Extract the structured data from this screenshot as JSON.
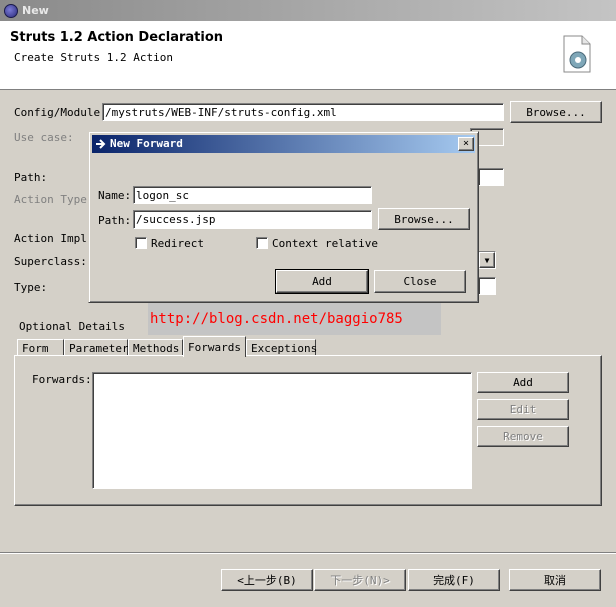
{
  "window": {
    "title": "New"
  },
  "header": {
    "title": "Struts 1.2 Action Declaration",
    "subtitle": "Create Struts 1.2 Action"
  },
  "form": {
    "config_label": "Config/Module:",
    "config_value": "/mystruts/WEB-INF/struts-config.xml",
    "browse_label": "Browse...",
    "usecase_label": "Use case:",
    "path_label": "Path:",
    "action_type_label": "Action Type:",
    "action_impl_label": "Action Impl:",
    "superclass_label": "Superclass:",
    "type_label": "Type:"
  },
  "dialog": {
    "title": "New Forward",
    "close_glyph": "×",
    "name_label": "Name:",
    "name_value": "logon_sc",
    "path_label": "Path:",
    "path_value": "/success.jsp",
    "browse_label": "Browse...",
    "redirect_label": "Redirect",
    "context_relative_label": "Context relative",
    "add_label": "Add",
    "close_label": "Close"
  },
  "optional": {
    "label": "Optional Details",
    "tabs": [
      "Form",
      "Parameter",
      "Methods",
      "Forwards",
      "Exceptions"
    ],
    "active_tab": "Forwards",
    "forwards_label": "Forwards:",
    "add_label": "Add",
    "edit_label": "Edit",
    "remove_label": "Remove"
  },
  "watermark": "http://blog.csdn.net/baggio785",
  "footer": {
    "back_label": "<上一步(B)",
    "next_label": "下一步(N)>",
    "finish_label": "完成(F)",
    "cancel_label": "取消"
  },
  "icons": {
    "window_icon": "eclipse-icon",
    "wizard_icon": "page-gear-icon",
    "dropdown_icon": "chevron-down-icon",
    "forward_icon": "arrow-icon"
  }
}
